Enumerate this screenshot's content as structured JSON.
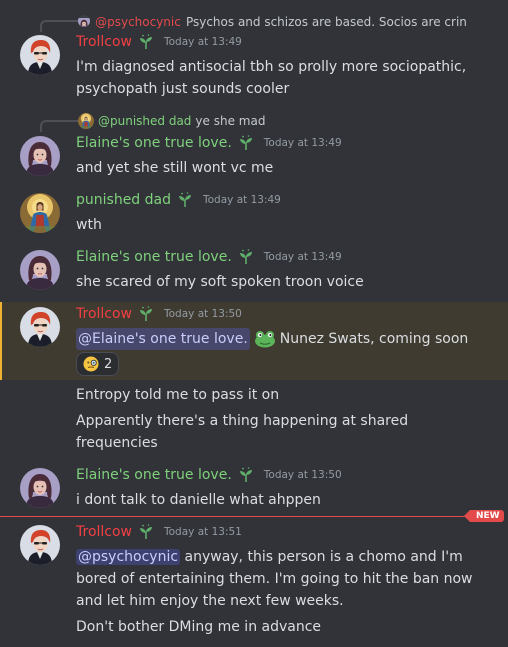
{
  "colors": {
    "trollcow": "#f23f43",
    "elaine": "#7fd17c",
    "punished": "#7fd17c",
    "reply_name": "#e34b4b"
  },
  "icons": [
    "seedling-badge-icon",
    "frog-emoji-icon",
    "monocle-emoji-icon"
  ],
  "messages": {
    "m1": {
      "reply_name": "@psychocynic",
      "reply_text": "Psychos and schizos are based. Socios are crin",
      "author": "Trollcow",
      "timestamp": "Today at 13:49",
      "lines": [
        "I'm diagnosed antisocial tbh so prolly more sociopathic,",
        "psychopath just sounds cooler"
      ]
    },
    "m2": {
      "reply_name": "@punished dad",
      "reply_text": "ye she mad",
      "author": "Elaine's  one true love.",
      "timestamp": "Today at 13:49",
      "text": "and yet she still wont vc me"
    },
    "m3": {
      "author": "punished dad",
      "timestamp": "Today at 13:49",
      "text": "wth"
    },
    "m4": {
      "author": "Elaine's  one true love.",
      "timestamp": "Today at 13:49",
      "text": "she scared of my soft spoken troon voice"
    },
    "m5": {
      "author": "Trollcow",
      "timestamp": "Today at 13:50",
      "mention": "@Elaine's  one true love.",
      "text": "Nunez Swats, coming soon",
      "reaction_count": "2",
      "followup1": "Entropy told me to pass it on",
      "followup2_l1": "Apparently there's a thing happening at shared",
      "followup2_l2": "frequencies"
    },
    "m6": {
      "author": "Elaine's  one true love.",
      "timestamp": "Today at 13:50",
      "text": "i dont talk to danielle what ahppen"
    },
    "m7": {
      "new_label": "NEW",
      "author": "Trollcow",
      "timestamp": "Today at 13:51",
      "mention": "@psychocynic",
      "line1": "anyway, this person is a chomo and I'm",
      "line2": "bored of entertaining them. I'm going to hit the ban now",
      "line3": "and let him enjoy the next few weeks.",
      "followup": "Don't bother DMing me in advance"
    }
  }
}
